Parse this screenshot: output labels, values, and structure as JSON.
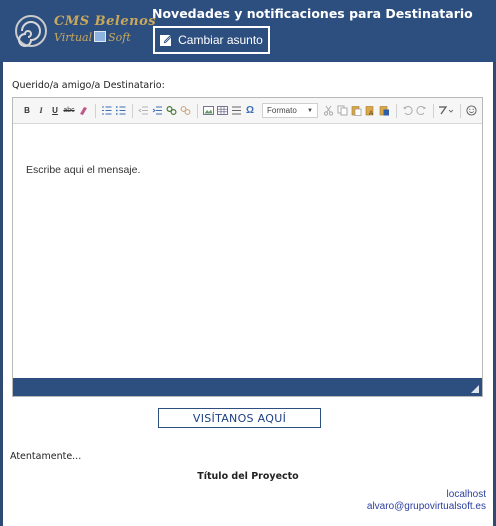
{
  "header": {
    "logo": {
      "line1": "CMS Belenos",
      "line2_a": "Virtual",
      "line2_b": "Soft"
    },
    "title": "Novedades y notificaciones para Destinatario",
    "change_subject_label": "Cambiar asunto"
  },
  "greeting": "Querido/a amigo/a Destinatario:",
  "editor": {
    "toolbar": {
      "bold": "B",
      "italic": "I",
      "underline": "U",
      "strike": "abc",
      "format_label": "Formato",
      "omega": "Ω"
    },
    "placeholder": "Escribe aqui el mensaje."
  },
  "visit_label": "VISÍTANOS AQUÍ",
  "closing": "Atentamente...",
  "project_title": "Título del Proyecto",
  "footer": {
    "host": "localhost",
    "email": "alvaro@grupovirtualsoft.es"
  },
  "colors": {
    "header_bg": "#2d4f80",
    "accent_blue": "#1d3f86",
    "logo_gold": "#c9a85c"
  }
}
